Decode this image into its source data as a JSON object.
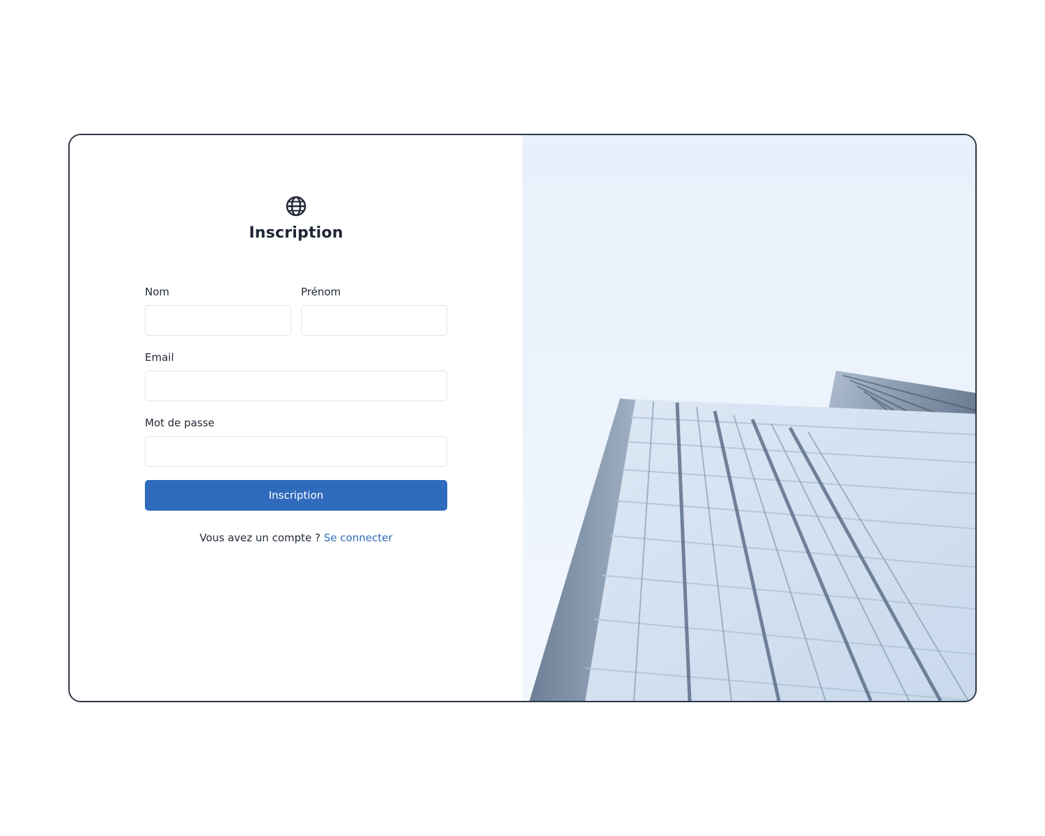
{
  "form": {
    "title": "Inscription",
    "logo_icon": "globe-icon",
    "fields": {
      "nom": {
        "label": "Nom",
        "value": "",
        "placeholder": ""
      },
      "prenom": {
        "label": "Prénom",
        "value": "",
        "placeholder": ""
      },
      "email": {
        "label": "Email",
        "value": "",
        "placeholder": ""
      },
      "password": {
        "label": "Mot de passe",
        "value": "",
        "placeholder": ""
      }
    },
    "submit_label": "Inscription",
    "footer_text": "Vous avez un compte ?",
    "footer_link": "Se connecter"
  },
  "colors": {
    "primary": "#2f6abc",
    "card_border": "#2b3545",
    "image_background": "#e9f1fc"
  },
  "image": {
    "subject": "building-photo"
  }
}
